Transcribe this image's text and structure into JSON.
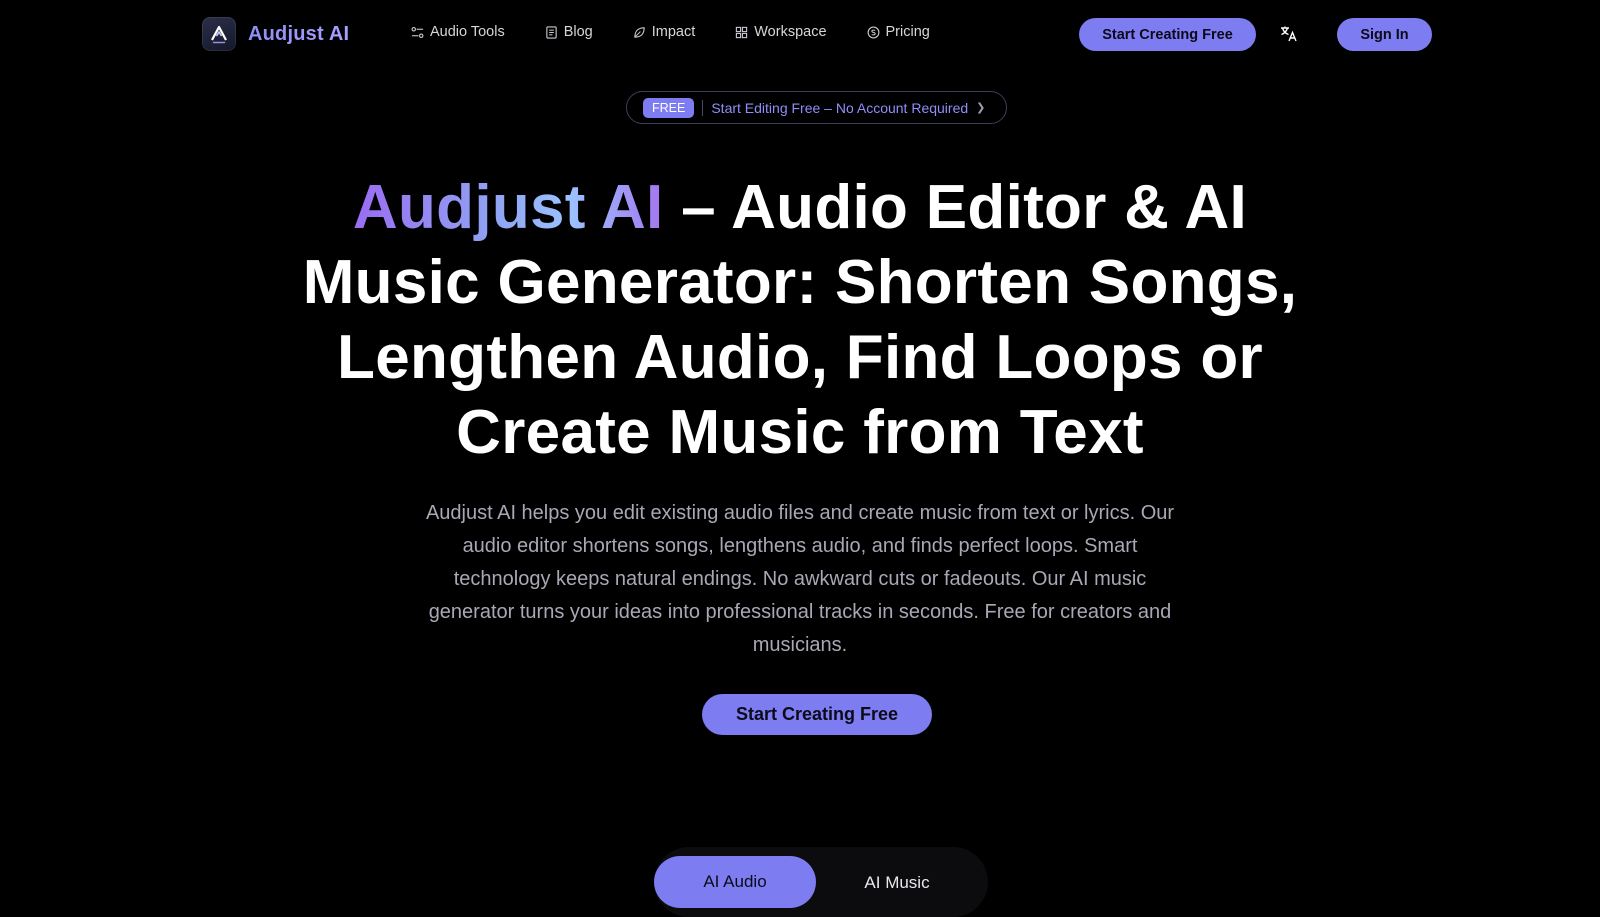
{
  "brand": {
    "name": "Audjust AI"
  },
  "nav": {
    "links": [
      {
        "label": "Audio Tools",
        "icon": "sliders-icon"
      },
      {
        "label": "Blog",
        "icon": "document-icon"
      },
      {
        "label": "Impact",
        "icon": "leaf-icon"
      },
      {
        "label": "Workspace",
        "icon": "grid-icon"
      },
      {
        "label": "Pricing",
        "icon": "coin-icon"
      }
    ],
    "cta_label": "Start Creating Free",
    "signin_label": "Sign In"
  },
  "promo": {
    "tag": "FREE",
    "text": "Start Editing Free – No Account Required"
  },
  "hero": {
    "title_highlight": "Audjust AI",
    "title_rest": " – Audio Editor & AI Music Generator: Shorten Songs, Lengthen Audio, Find Loops or Create Music from Text",
    "description": "Audjust AI helps you edit existing audio files and create music from text or lyrics. Our audio editor shortens songs, lengthens audio, and finds perfect loops. Smart technology keeps natural endings. No awkward cuts or fadeouts. Our AI music generator turns your ideas into professional tracks in seconds. Free for creators and musicians.",
    "cta_label": "Start Creating Free"
  },
  "tabs": {
    "items": [
      {
        "label": "AI Audio",
        "active": true
      },
      {
        "label": "AI Music",
        "active": false
      }
    ]
  },
  "colors": {
    "accent": "#7d7cf0",
    "background": "#000000",
    "promo_text": "#8f8ef8"
  }
}
